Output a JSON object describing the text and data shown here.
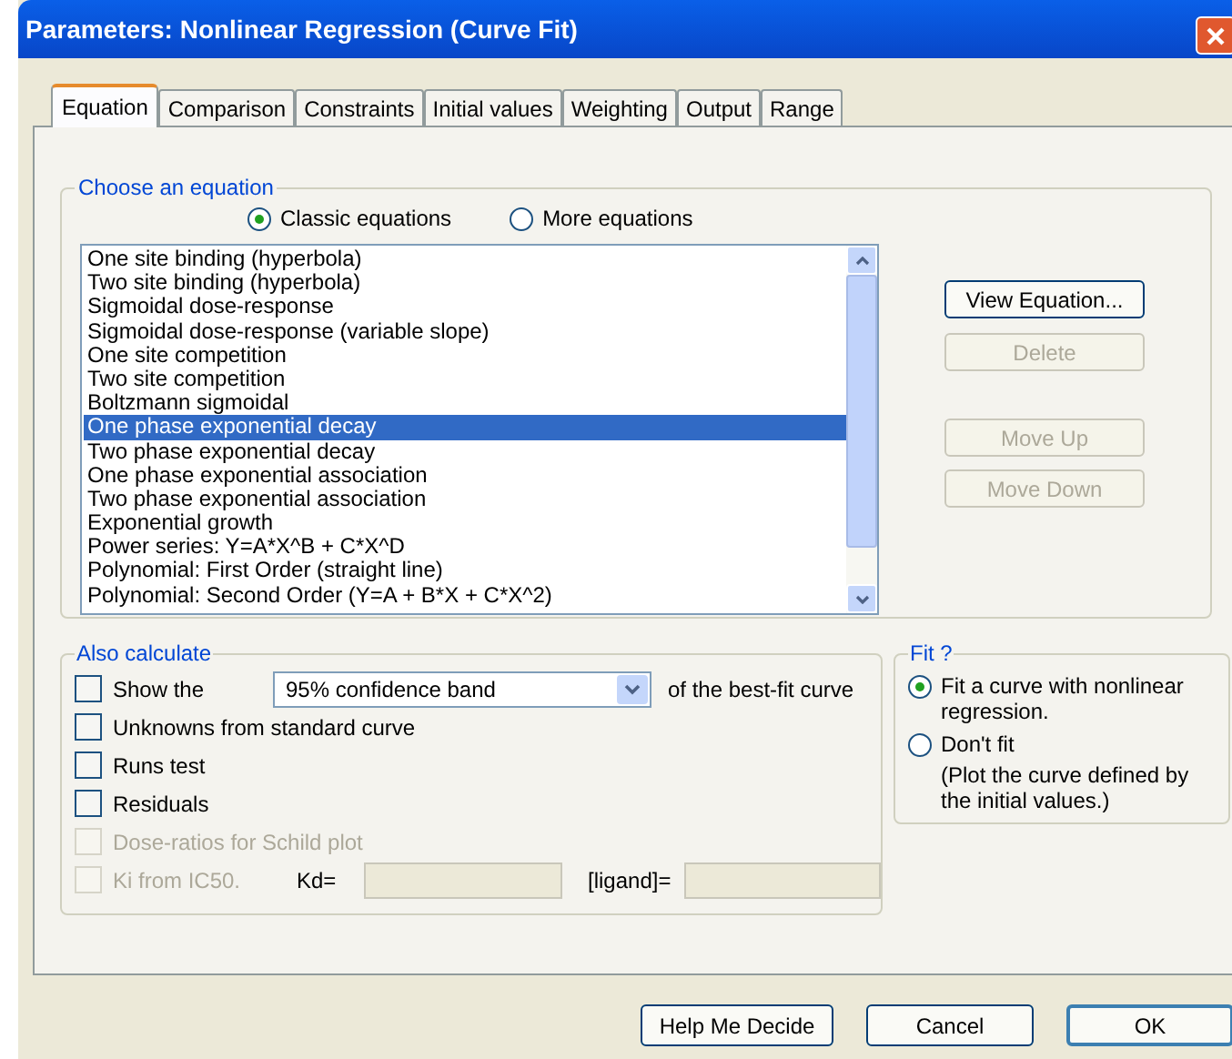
{
  "window": {
    "title": "Parameters: Nonlinear Regression (Curve Fit)"
  },
  "tabs": [
    {
      "label": "Equation",
      "selected": true
    },
    {
      "label": "Comparison",
      "selected": false
    },
    {
      "label": "Constraints",
      "selected": false
    },
    {
      "label": "Initial values",
      "selected": false
    },
    {
      "label": "Weighting",
      "selected": false
    },
    {
      "label": "Output",
      "selected": false
    },
    {
      "label": "Range",
      "selected": false
    }
  ],
  "equation_group": {
    "label": "Choose an equation",
    "radios": [
      {
        "label": "Classic equations",
        "selected": true
      },
      {
        "label": "More equations",
        "selected": false
      }
    ],
    "list": [
      {
        "label": "One site binding (hyperbola)",
        "selected": false
      },
      {
        "label": "Two site binding (hyperbola)",
        "selected": false
      },
      {
        "label": "Sigmoidal dose-response",
        "selected": false
      },
      {
        "label": "Sigmoidal dose-response (variable slope)",
        "selected": false
      },
      {
        "label": "One site competition",
        "selected": false
      },
      {
        "label": "Two site competition",
        "selected": false
      },
      {
        "label": "Boltzmann sigmoidal",
        "selected": false
      },
      {
        "label": "One phase exponential decay",
        "selected": true
      },
      {
        "label": "Two phase exponential decay",
        "selected": false
      },
      {
        "label": "One phase exponential association",
        "selected": false
      },
      {
        "label": "Two phase exponential association",
        "selected": false
      },
      {
        "label": "Exponential growth",
        "selected": false
      },
      {
        "label": "Power series: Y=A*X^B + C*X^D",
        "selected": false
      },
      {
        "label": "Polynomial: First Order (straight line)",
        "selected": false
      },
      {
        "label": "Polynomial: Second Order (Y=A + B*X + C*X^2)",
        "selected": false
      }
    ],
    "buttons": [
      {
        "label": "View Equation...",
        "disabled": false
      },
      {
        "label": "Delete",
        "disabled": true
      },
      {
        "label": "Move Up",
        "disabled": true
      },
      {
        "label": "Move Down",
        "disabled": true
      }
    ]
  },
  "also_calculate": {
    "label": "Also calculate",
    "items": [
      {
        "kind": "select",
        "label": "Show the",
        "value": "95% confidence band",
        "suffix": "of the best-fit curve",
        "checked": false,
        "disabled": false
      },
      {
        "kind": "checkbox",
        "label": "Unknowns from standard curve",
        "checked": false,
        "disabled": false
      },
      {
        "kind": "checkbox",
        "label": "Runs test",
        "checked": false,
        "disabled": false
      },
      {
        "kind": "checkbox",
        "label": "Residuals",
        "checked": false,
        "disabled": false
      },
      {
        "kind": "checkbox",
        "label": "Dose-ratios for Schild plot",
        "checked": false,
        "disabled": true
      },
      {
        "kind": "ki",
        "label": "Ki from IC50.",
        "kd_label": "Kd=",
        "ligand_label": "[ligand]=",
        "checked": false,
        "disabled": true
      }
    ]
  },
  "fit": {
    "label": "Fit ?",
    "options": [
      {
        "label": "Fit a curve with nonlinear regression.",
        "selected": true
      },
      {
        "label": "Don't fit",
        "note": "(Plot the curve defined by the initial values.)",
        "selected": false
      }
    ]
  },
  "buttons": [
    {
      "label": "Help Me Decide",
      "default": false
    },
    {
      "label": "Cancel",
      "default": false
    },
    {
      "label": "OK",
      "default": true
    }
  ]
}
